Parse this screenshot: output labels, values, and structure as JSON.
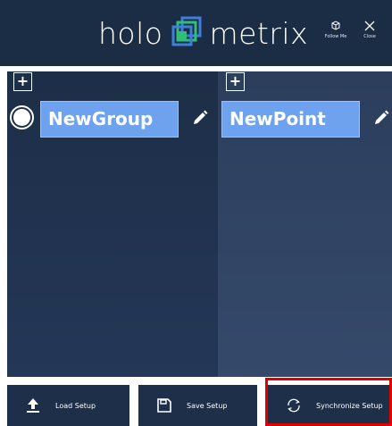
{
  "header": {
    "brand_left": "holo",
    "brand_right": "metrix",
    "follow_me_label": "Follow Me",
    "close_label": "Close",
    "logo_icon": "holometrix-logo-icon"
  },
  "groups_panel": {
    "add_label": "+",
    "group_name": "NewGroup",
    "selected": true
  },
  "points_panel": {
    "add_label": "+",
    "point_name": "NewPoint"
  },
  "footer": {
    "load_label": "Load Setup",
    "save_label": "Save Setup",
    "sync_label": "Synchronize Setup"
  },
  "colors": {
    "header_bg": "#1b2c45",
    "name_box": "#6fa2ee",
    "highlight": "#e00000",
    "logo_green": "#2fbf7a",
    "logo_blue": "#3f7fd9"
  }
}
